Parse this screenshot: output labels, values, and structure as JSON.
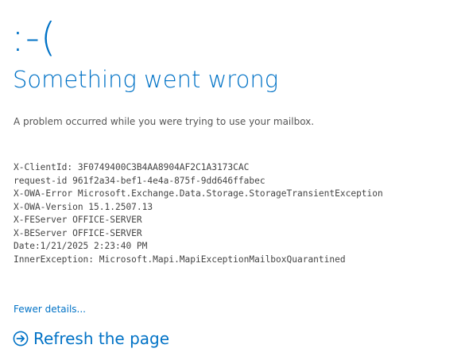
{
  "error_page": {
    "face": ":-(",
    "title": "Something went wrong",
    "message": "A problem occurred while you were trying to use your mailbox.",
    "details": [
      "X-ClientId: 3F0749400C3B4AA8904AF2C1A3173CAC",
      "request-id 961f2a34-bef1-4e4a-875f-9dd646ffabec",
      "X-OWA-Error Microsoft.Exchange.Data.Storage.StorageTransientException",
      "X-OWA-Version 15.1.2507.13",
      "X-FEServer OFFICE-SERVER",
      "X-BEServer OFFICE-SERVER",
      "Date:1/21/2025 2:23:40 PM",
      "InnerException: Microsoft.Mapi.MapiExceptionMailboxQuarantined"
    ],
    "toggle_details_label": "Fewer details...",
    "refresh_label": "Refresh the page",
    "refresh_icon": "arrow-circle-right-icon"
  },
  "colors": {
    "accent": "#0072C6",
    "text": "#444444",
    "background": "#ffffff"
  }
}
